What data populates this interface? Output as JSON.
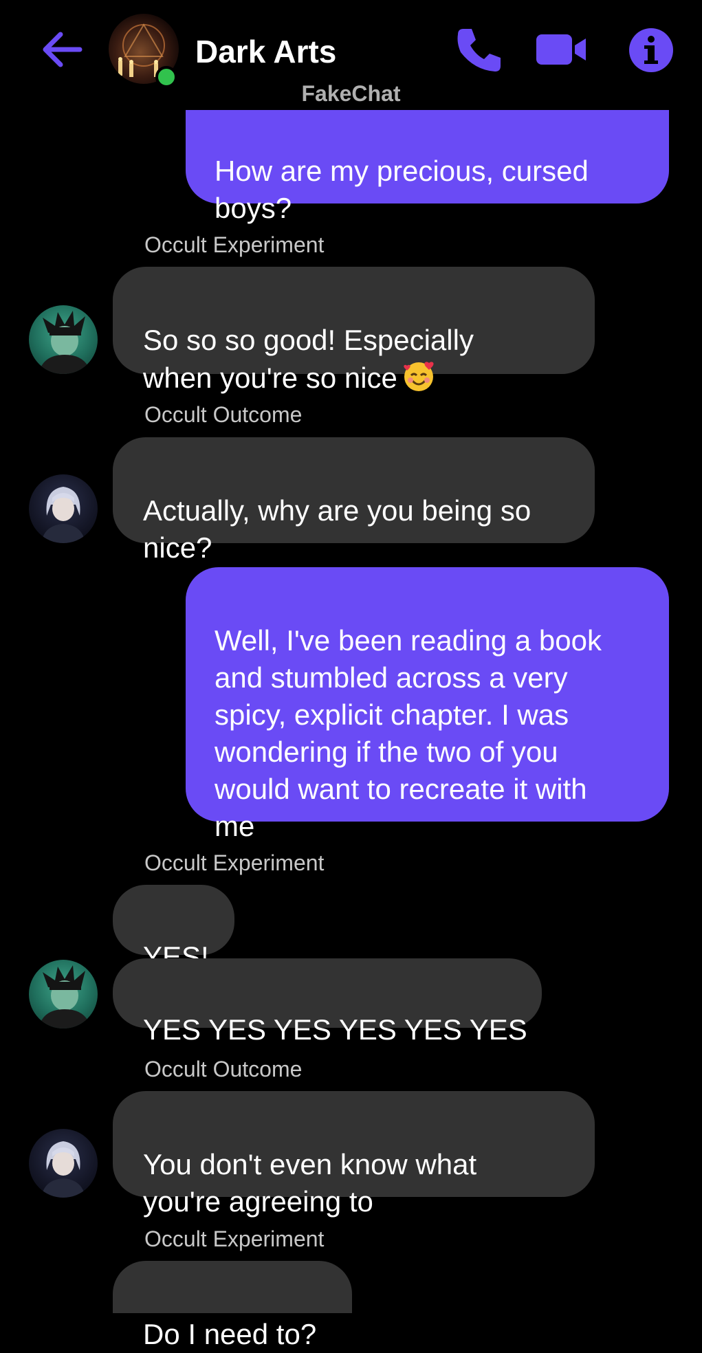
{
  "header": {
    "title": "Dark Arts",
    "subtitle": "FakeChat",
    "back_icon": "arrow-left-icon",
    "call_icon": "phone-icon",
    "video_icon": "video-camera-icon",
    "info_icon": "info-icon",
    "accent_color": "#6a4bf5",
    "online_color": "#31c24d"
  },
  "messages": [
    {
      "direction": "outgoing",
      "text": "How are my precious, cursed\nboys?"
    },
    {
      "direction": "incoming",
      "sender": "Occult Experiment",
      "text": "So so so good!  Especially\nwhen you're so nice",
      "emoji": "smiling-face-with-hearts"
    },
    {
      "direction": "incoming",
      "sender": "Occult Outcome",
      "text": "Actually, why are you being so\nnice?"
    },
    {
      "direction": "outgoing",
      "text": "Well, I've been reading a book\nand stumbled across a very\nspicy, explicit chapter.  I was\nwondering if the two of you\nwould want to recreate it with\nme"
    },
    {
      "direction": "incoming",
      "sender": "Occult Experiment",
      "text": "YES!"
    },
    {
      "direction": "incoming",
      "text": "YES YES YES YES YES YES"
    },
    {
      "direction": "incoming",
      "sender": "Occult Outcome",
      "text": "You don't even know what\nyou're agreeing to"
    },
    {
      "direction": "incoming",
      "sender": "Occult Experiment",
      "text": "Do I need to?"
    }
  ]
}
